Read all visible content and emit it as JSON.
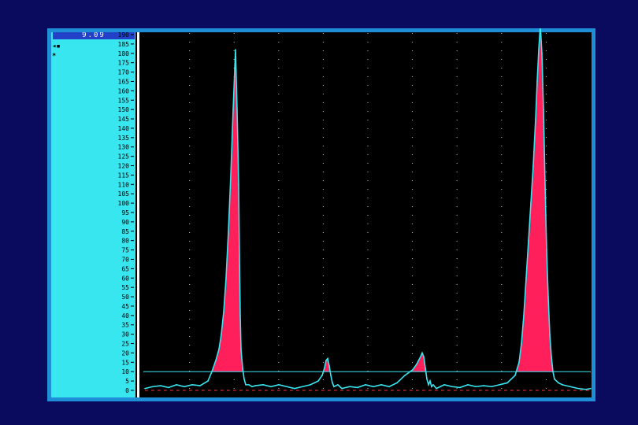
{
  "readout": "9.09",
  "markers": [
    "◂▪",
    "✶"
  ],
  "colors": {
    "background": "#0a0a5e",
    "frame": "#1e8fd6",
    "axis_panel": "#38e6f0",
    "plot_background": "#000000",
    "curve": "#38e6f0",
    "fill": "#ff1f5a",
    "grid": "#c8c8c8",
    "threshold_line": "#38e6f0",
    "baseline": "#ff3030"
  },
  "chart_data": {
    "type": "area",
    "title": "",
    "xlabel": "",
    "ylabel": "",
    "ylim": [
      0,
      190
    ],
    "y_ticks": [
      0,
      5,
      10,
      15,
      20,
      25,
      30,
      35,
      40,
      45,
      50,
      55,
      60,
      65,
      70,
      75,
      80,
      85,
      90,
      95,
      100,
      105,
      110,
      115,
      120,
      125,
      130,
      135,
      140,
      145,
      150,
      155,
      160,
      165,
      170,
      175,
      180,
      185,
      190
    ],
    "threshold": 10,
    "grid": true,
    "x": [
      0,
      10,
      20,
      30,
      40,
      50,
      60,
      70,
      80,
      85,
      90,
      94,
      97,
      100,
      103,
      106,
      109,
      112,
      115,
      117,
      119,
      120,
      121,
      122,
      124,
      126,
      128,
      132,
      136,
      140,
      150,
      160,
      170,
      180,
      190,
      200,
      210,
      220,
      225,
      228,
      230,
      232,
      234,
      236,
      238,
      240,
      245,
      250,
      260,
      270,
      280,
      290,
      300,
      310,
      320,
      330,
      340,
      345,
      350,
      352,
      354,
      356,
      358,
      360,
      362,
      364,
      366,
      368,
      370,
      375,
      380,
      390,
      400,
      410,
      420,
      430,
      440,
      450,
      460,
      470,
      475,
      478,
      481,
      484,
      487,
      490,
      493,
      496,
      498,
      500,
      502,
      504,
      506,
      508,
      510,
      512,
      514,
      516,
      518,
      520,
      525,
      530,
      540,
      550,
      560,
      566
    ],
    "y": [
      1,
      2,
      2.5,
      1.5,
      3,
      2,
      3,
      2.5,
      5,
      10,
      16,
      22,
      30,
      42,
      60,
      85,
      115,
      150,
      182,
      150,
      110,
      72,
      40,
      22,
      12,
      6,
      3,
      3,
      2,
      2.5,
      3,
      2,
      3,
      2,
      1,
      2,
      3,
      5,
      8,
      12,
      16,
      17,
      13,
      8,
      4,
      2,
      3,
      1,
      2,
      1.5,
      3,
      2,
      3,
      2,
      4,
      8,
      11,
      14,
      18,
      20,
      18,
      12,
      6,
      3,
      5,
      2,
      3,
      2,
      1,
      2,
      3,
      2,
      1.5,
      3,
      2,
      2.5,
      2,
      3,
      4,
      8,
      15,
      25,
      40,
      60,
      80,
      100,
      120,
      145,
      165,
      182,
      195,
      180,
      150,
      110,
      75,
      50,
      30,
      18,
      10,
      6,
      4,
      3,
      2,
      1,
      0.5,
      1
    ]
  }
}
